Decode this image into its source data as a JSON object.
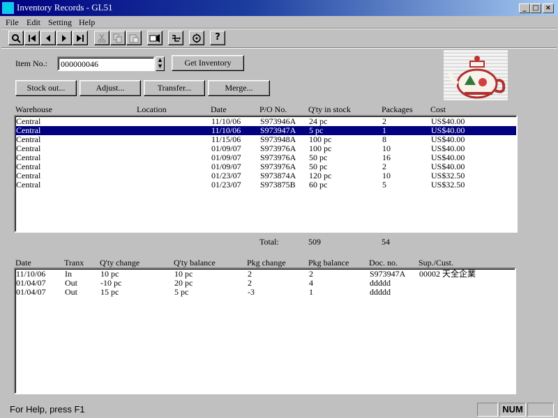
{
  "window": {
    "title": "Inventory Records - GL51",
    "minimize": "_",
    "maximize": "□",
    "close": "×"
  },
  "menu": [
    "File",
    "Edit",
    "Setting",
    "Help"
  ],
  "toolbar_icons": [
    "search-icon",
    "first-record-icon",
    "previous-record-icon",
    "next-record-icon",
    "last-record-icon",
    "cut-icon",
    "copy-icon",
    "paste-icon",
    "print-preview-icon",
    "merge-icon",
    "options-icon",
    "help-icon"
  ],
  "form": {
    "item_label": "Item No.:",
    "item_value": "000000046",
    "get_inventory": "Get Inventory",
    "stock_out": "Stock out...",
    "adjust": "Adjust...",
    "transfer": "Transfer...",
    "merge": "Merge..."
  },
  "stock": {
    "headers": [
      "Warehouse",
      "Location",
      "Date",
      "P/O No.",
      "Q'ty in stock",
      "Packages",
      "Cost"
    ],
    "rows": [
      [
        "Central",
        "",
        "11/10/06",
        "S973946A",
        "24 pc",
        "2",
        "US$40.00"
      ],
      [
        "Central",
        "",
        "11/10/06",
        "S973947A",
        "5 pc",
        "1",
        "US$40.00"
      ],
      [
        "Central",
        "",
        "11/15/06",
        "S973948A",
        "100 pc",
        "8",
        "US$40.00"
      ],
      [
        "Central",
        "",
        "01/09/07",
        "S973976A",
        "100 pc",
        "10",
        "US$40.00"
      ],
      [
        "Central",
        "",
        "01/09/07",
        "S973976A",
        "50 pc",
        "16",
        "US$40.00"
      ],
      [
        "Central",
        "",
        "01/09/07",
        "S973976A",
        "50 pc",
        "2",
        "US$40.00"
      ],
      [
        "Central",
        "",
        "01/23/07",
        "S973874A",
        "120 pc",
        "10",
        "US$32.50"
      ],
      [
        "Central",
        "",
        "01/23/07",
        "S973875B",
        "60 pc",
        "5",
        "US$32.50"
      ]
    ],
    "selected_index": 1,
    "total_label": "Total:",
    "total_qty": "509",
    "total_packages": "54"
  },
  "transactions": {
    "headers": [
      "Date",
      "Tranx",
      "Q'ty change",
      "Q'ty balance",
      "Pkg change",
      "Pkg balance",
      "Doc. no.",
      "Sup./Cust."
    ],
    "rows": [
      [
        "11/10/06",
        "In",
        "10 pc",
        "10 pc",
        "2",
        "2",
        "S973947A",
        "00002 天全企業"
      ],
      [
        "01/04/07",
        "Out",
        "-10 pc",
        "20 pc",
        "2",
        "4",
        "ddddd",
        ""
      ],
      [
        "01/04/07",
        "Out",
        "15 pc",
        "5 pc",
        "-3",
        "1",
        "ddddd",
        ""
      ]
    ]
  },
  "status": {
    "help_text": "For Help, press F1",
    "num": "NUM"
  },
  "colors": {
    "title_start": "#000080",
    "title_end": "#a6caf0",
    "selection": "#000080",
    "face": "#c0c0c0"
  }
}
